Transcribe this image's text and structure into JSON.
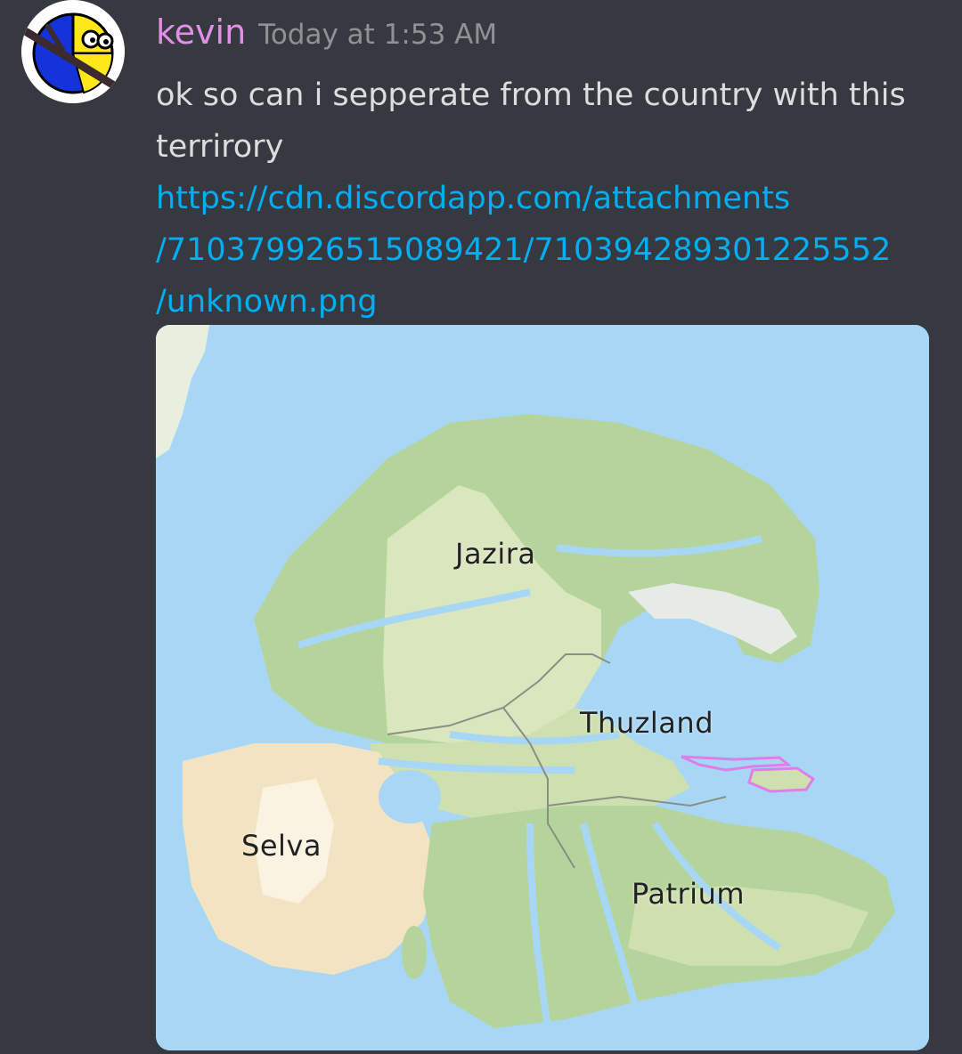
{
  "message": {
    "author": "kevin",
    "timestamp": "Today at 1:53 AM",
    "text_lines": [
      "ok so can i sepperate from the country with this",
      "terrirory"
    ],
    "link_lines": [
      "https://cdn.discordapp.com/attachments",
      "/710379926515089421/710394289301225552",
      "/unknown.png"
    ]
  },
  "attachment": {
    "labels": {
      "jazira": "Jazira",
      "thuzland": "Thuzland",
      "selva": "Selva",
      "patrium": "Patrium"
    }
  },
  "colors": {
    "background": "#36393f",
    "username": "#e48ee8",
    "timestamp": "#8e9297",
    "text": "#dcddde",
    "link": "#00aff4",
    "sea": "#a8d7f5",
    "land_green": "#b5d49b",
    "land_light": "#d9e6be",
    "desert": "#f2e3c2",
    "highlight": "#e07de8"
  }
}
